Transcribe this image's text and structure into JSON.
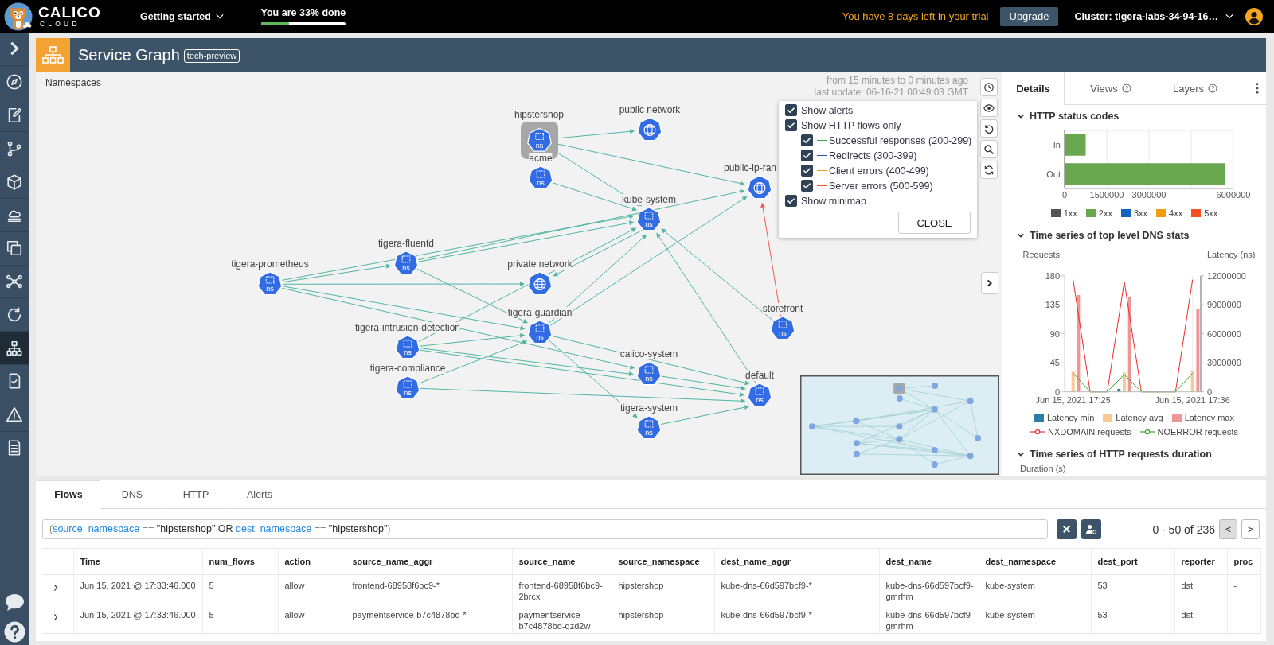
{
  "topbar": {
    "logo": {
      "name": "CALICO",
      "sub": "CLOUD"
    },
    "menu": {
      "label": "Getting started"
    },
    "progress": {
      "label": "You are 33% done",
      "level": 0.33
    },
    "trial": "You have 8 days left in your trial",
    "upgrade": "Upgrade",
    "cluster": "Cluster: tigera-labs-34-94-16…"
  },
  "sidebar": {
    "items": [
      {
        "selected": false
      },
      {
        "selected": false
      },
      {
        "selected": false
      },
      {
        "selected": false
      },
      {
        "selected": false
      },
      {
        "selected": false
      },
      {
        "selected": false
      },
      {
        "selected": false
      },
      {
        "selected": true
      },
      {
        "selected": false
      },
      {
        "selected": false
      },
      {
        "selected": false
      }
    ]
  },
  "page": {
    "title": "Service Graph",
    "badge": "tech-preview"
  },
  "graph": {
    "heading": "Namespaces",
    "time_range": "from 15 minutes to 0 minutes ago",
    "last_update": "last update: 06-16-21 00:49:03 GMT",
    "nodes": [
      {
        "label": "public network",
        "kind": "network",
        "selected": false
      },
      {
        "label": "hipstershop",
        "kind": "namespace",
        "tag": "ns",
        "selected": true
      },
      {
        "label": "acme",
        "kind": "namespace",
        "tag": "ns",
        "selected": false
      },
      {
        "label": "public-ip-ran",
        "kind": "network",
        "selected": false
      },
      {
        "label": "kube-system",
        "kind": "namespace",
        "tag": "ns",
        "selected": false
      },
      {
        "label": "tigera-fluentd",
        "kind": "namespace",
        "tag": "ns",
        "selected": false
      },
      {
        "label": "tigera-prometheus",
        "kind": "namespace",
        "tag": "ns",
        "selected": false
      },
      {
        "label": "private network",
        "kind": "network",
        "selected": false
      },
      {
        "label": "storefront",
        "kind": "namespace",
        "tag": "ns",
        "selected": false
      },
      {
        "label": "tigera-guardian",
        "kind": "namespace",
        "tag": "ns",
        "selected": false
      },
      {
        "label": "tigera-intrusion-detection",
        "kind": "namespace",
        "tag": "ns",
        "selected": false
      },
      {
        "label": "calico-system",
        "kind": "namespace",
        "tag": "ns",
        "selected": false
      },
      {
        "label": "tigera-compliance",
        "kind": "namespace",
        "tag": "ns",
        "selected": false
      },
      {
        "label": "default",
        "kind": "namespace",
        "tag": "ns",
        "selected": false
      },
      {
        "label": "tigera-system",
        "kind": "namespace",
        "tag": "ns",
        "selected": false
      }
    ],
    "edges": [
      {
        "kind": "flow"
      },
      {
        "kind": "flow"
      },
      {
        "kind": "flow"
      },
      {
        "kind": "flow"
      },
      {
        "kind": "flow"
      },
      {
        "kind": "flow"
      },
      {
        "kind": "flow"
      },
      {
        "kind": "flow"
      },
      {
        "kind": "flow"
      },
      {
        "kind": "flow"
      },
      {
        "kind": "flow"
      },
      {
        "kind": "flow"
      },
      {
        "kind": "flow"
      },
      {
        "kind": "flow"
      },
      {
        "kind": "flow"
      },
      {
        "kind": "flow"
      },
      {
        "kind": "flow"
      },
      {
        "kind": "flow"
      },
      {
        "kind": "flow"
      },
      {
        "kind": "flow"
      },
      {
        "kind": "flow"
      },
      {
        "kind": "flow"
      },
      {
        "kind": "flow"
      },
      {
        "kind": "flow"
      },
      {
        "kind": "flow"
      },
      {
        "kind": "error"
      },
      {
        "kind": "flow"
      },
      {
        "kind": "flow"
      }
    ],
    "options": {
      "items": [
        {
          "label": "Show alerts",
          "checked": true
        },
        {
          "label": "Show HTTP flows only",
          "checked": true,
          "children": [
            {
              "label": "Successful responses (200-299)",
              "checked": true,
              "color": "#35a843"
            },
            {
              "label": "Redirects (300-399)",
              "checked": true,
              "color": "#2a4fa0"
            },
            {
              "label": "Client errors (400-499)",
              "checked": true,
              "color": "#f39c12"
            },
            {
              "label": "Server errors (500-599)",
              "checked": true,
              "color": "#f0532d"
            }
          ]
        },
        {
          "label": "Show minimap",
          "checked": true
        }
      ],
      "close": "CLOSE"
    }
  },
  "details": {
    "tabs": [
      {
        "label": "Details",
        "selected": true,
        "help": false
      },
      {
        "label": "Views",
        "selected": false,
        "help": true
      },
      {
        "label": "Layers",
        "selected": false,
        "help": true
      }
    ],
    "sections": [
      {
        "title": "HTTP status codes",
        "expanded": true,
        "chart_data": {
          "type": "bar",
          "orientation": "horizontal",
          "categories": [
            "In",
            "Out"
          ],
          "series": [
            {
              "name": "1xx",
              "color": "#555555",
              "values": [
                0,
                0
              ]
            },
            {
              "name": "2xx",
              "color": "#6aa84f",
              "values": [
                750000,
                5700000
              ]
            },
            {
              "name": "3xx",
              "color": "#1565c0",
              "values": [
                0,
                0
              ]
            },
            {
              "name": "4xx",
              "color": "#f39c12",
              "values": [
                0,
                0
              ]
            },
            {
              "name": "5xx",
              "color": "#f4511e",
              "values": [
                0,
                0
              ]
            }
          ],
          "xlim": [
            0,
            6000000
          ],
          "xticks": [
            0,
            1500000,
            3000000,
            6000000
          ],
          "legend": "bottom"
        }
      },
      {
        "title": "Time series of top level DNS stats",
        "expanded": true,
        "chart_data": {
          "type": "bar",
          "categories": [
            "Jun 15, 2021 17:25",
            null,
            null,
            null,
            null,
            null,
            null,
            "Jun 15, 2021 17:36"
          ],
          "ylabel": "Requests",
          "ylim": [
            0,
            180
          ],
          "yticks": [
            0,
            45,
            90,
            135,
            180
          ],
          "y2label": "Latency (ns)",
          "y2lim": [
            0,
            12000000
          ],
          "y2ticks": [
            0,
            3000000,
            6000000,
            9000000,
            12000000
          ],
          "series": [
            {
              "name": "Latency min",
              "type": "bar",
              "axis": "y2",
              "color": "#2b7ea8",
              "values": [
                0,
                0,
                0,
                300000,
                0,
                0,
                0,
                0
              ]
            },
            {
              "name": "Latency avg",
              "type": "bar",
              "axis": "y2",
              "color": "#fbc896",
              "values": [
                2100000,
                0,
                0,
                2000000,
                0,
                0,
                0,
                2200000
              ]
            },
            {
              "name": "Latency max",
              "type": "bar",
              "axis": "y2",
              "color": "#ee9595",
              "values": [
                10000000,
                0,
                0,
                9800000,
                0,
                0,
                0,
                8600000
              ]
            },
            {
              "name": "NXDOMAIN requests",
              "type": "line",
              "color": "#ee2b2b",
              "values": [
                174,
                0,
                0,
                171,
                0,
                0,
                0,
                174
              ]
            },
            {
              "name": "NOERROR requests",
              "type": "line",
              "color": "#3aa52a",
              "values": [
                29,
                0,
                0,
                27,
                0,
                0,
                0,
                29
              ]
            }
          ],
          "legend": "bottom"
        }
      },
      {
        "title": "Time series of HTTP requests duration",
        "expanded": true,
        "ylabel": "Duration (s)"
      }
    ]
  },
  "flows": {
    "tabs": [
      {
        "label": "Flows",
        "selected": true
      },
      {
        "label": "DNS",
        "selected": false
      },
      {
        "label": "HTTP",
        "selected": false
      },
      {
        "label": "Alerts",
        "selected": false
      }
    ],
    "query": [
      {
        "text": "(",
        "kind": "open"
      },
      {
        "text": "source_namespace",
        "kind": "field"
      },
      {
        "text": "==",
        "kind": "operator"
      },
      {
        "text": "\"hipstershop\"",
        "kind": "value"
      },
      {
        "text": "OR",
        "kind": "keyword"
      },
      {
        "text": "dest_namespace",
        "kind": "field"
      },
      {
        "text": "==",
        "kind": "operator"
      },
      {
        "text": "\"hipstershop\"",
        "kind": "value"
      },
      {
        "text": ")",
        "kind": "close"
      }
    ],
    "pagination": {
      "range": "0 - 50 of 236",
      "prev": {
        "label": "<",
        "disabled": true
      },
      "next": {
        "label": ">",
        "disabled": false
      }
    },
    "table": {
      "columns": [
        "Time",
        "num_flows",
        "action",
        "source_name_aggr",
        "source_name",
        "source_namespace",
        "dest_name_aggr",
        "dest_name",
        "dest_namespace",
        "dest_port",
        "reporter",
        "proc"
      ],
      "rows": [
        {
          "expanded": false,
          "cells": [
            "Jun 15, 2021 @ 17:33:46.000",
            "5",
            "allow",
            "frontend-68958f6bc9-*",
            "frontend-68958f6bc9-2brcx",
            "hipstershop",
            "kube-dns-66d597bcf9-*",
            "kube-dns-66d597bcf9-gmrhm",
            "kube-system",
            "53",
            "dst",
            "-"
          ]
        },
        {
          "expanded": false,
          "cells": [
            "Jun 15, 2021 @ 17:33:46.000",
            "5",
            "allow",
            "paymentservice-b7c4878bd-*",
            "paymentservice-b7c4878bd-qzd2w",
            "hipstershop",
            "kube-dns-66d597bcf9-*",
            "kube-dns-66d597bcf9-gmrhm",
            "kube-system",
            "53",
            "dst",
            "-"
          ]
        }
      ]
    }
  }
}
